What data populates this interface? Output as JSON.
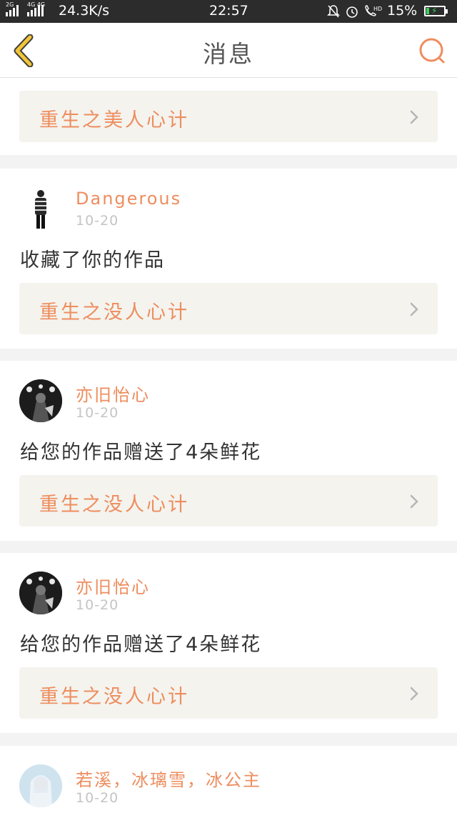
{
  "status_bar": {
    "network_left": "2G",
    "network_right": "4G 4G",
    "speed": "24.3K/s",
    "time": "22:57",
    "battery": "15%",
    "hd_label": "HD"
  },
  "header": {
    "title": "消息"
  },
  "top_card": {
    "work_title": "重生之美人心计"
  },
  "messages": [
    {
      "username": "Dangerous",
      "date": "10-20",
      "text": "收藏了你的作品",
      "work_title": "重生之没人心计"
    },
    {
      "username": "亦旧怡心",
      "date": "10-20",
      "text": "给您的作品赠送了4朵鲜花",
      "work_title": "重生之没人心计"
    },
    {
      "username": "亦旧怡心",
      "date": "10-20",
      "text": "给您的作品赠送了4朵鲜花",
      "work_title": "重生之没人心计"
    },
    {
      "username": "若溪，冰璃雪，冰公主",
      "date": "10-20"
    }
  ],
  "colors": {
    "accent": "#ee8d5e",
    "back_icon": "#f3c437",
    "status_bar_bg": "#2c2c2c",
    "work_link_bg": "#f4f3ee"
  },
  "icons": {
    "back": "chevron-left-icon",
    "search": "search-icon",
    "arrow": "chevron-right-icon"
  }
}
